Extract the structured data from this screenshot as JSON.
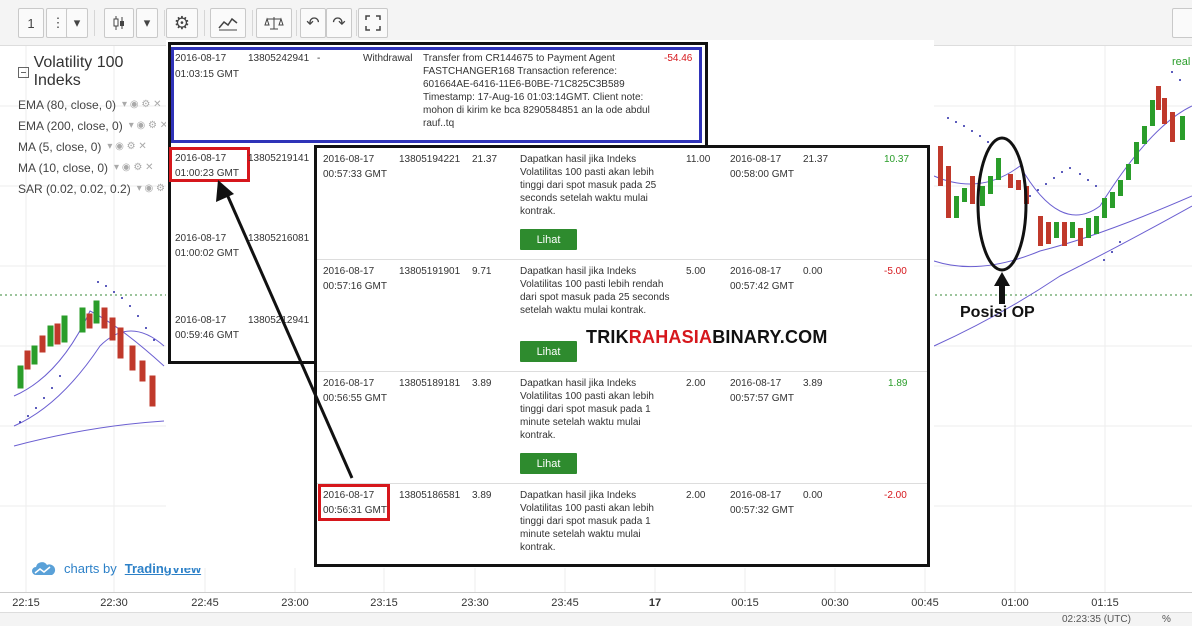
{
  "toolbar": {
    "interval": "1"
  },
  "chart": {
    "title": "Volatility 100 Indeks",
    "indicators": [
      "EMA (80, close, 0)",
      "EMA (200, close, 0)",
      "MA (5, close, 0)",
      "MA (10, close, 0)",
      "SAR (0.02, 0.02, 0.2)"
    ],
    "realtime_label": "real",
    "brand_prefix": "charts by",
    "brand_name": "TradingView",
    "time_ticks": [
      "22:15",
      "22:30",
      "22:45",
      "23:00",
      "23:15",
      "23:30",
      "23:45",
      "17",
      "00:15",
      "00:30",
      "00:45",
      "01:00",
      "01:15"
    ],
    "clock": "02:23:35 (UTC)",
    "percent": "%"
  },
  "withdrawal": {
    "date": "2016-08-17",
    "time": "01:03:15 GMT",
    "ref": "13805242941",
    "dash": "-",
    "type": "Withdrawal",
    "description": "Transfer from CR144675 to Payment Agent FASTCHANGER168 Transaction reference: 601664AE-6416-11E6-B0BE-71C825C3B589 Timestamp: 17-Aug-16 01:03:14GMT. Client note: mohon di kirim ke bca 8290584851 an la ode abdul rauf..tq",
    "amount": "-54.46"
  },
  "left_rows": [
    {
      "date": "2016-08-17",
      "time": "01:00:23 GMT",
      "ref": "13805219141"
    },
    {
      "date": "2016-08-17",
      "time": "01:00:02 GMT",
      "ref": "13805216081"
    },
    {
      "date": "2016-08-17",
      "time": "00:59:46 GMT",
      "ref": "13805212941"
    }
  ],
  "contracts": [
    {
      "date": "2016-08-17",
      "time": "00:57:33 GMT",
      "ref": "13805194221",
      "payout": "21.37",
      "description": "Dapatkan hasil jika Indeks Volatilitas 100 pasti akan lebih tinggi dari spot masuk pada 25 seconds setelah waktu mulai kontrak.",
      "stake": "11.00",
      "sell_date": "2016-08-17",
      "sell_time": "00:58:00 GMT",
      "sell_price": "21.37",
      "profit": "10.37",
      "button": "Lihat"
    },
    {
      "date": "2016-08-17",
      "time": "00:57:16 GMT",
      "ref": "13805191901",
      "payout": "9.71",
      "description": "Dapatkan hasil jika Indeks Volatilitas 100 pasti lebih rendah dari spot masuk pada 25 seconds setelah waktu mulai kontrak.",
      "stake": "5.00",
      "sell_date": "2016-08-17",
      "sell_time": "00:57:42 GMT",
      "sell_price": "0.00",
      "profit": "-5.00",
      "button": "Lihat"
    },
    {
      "date": "2016-08-17",
      "time": "00:56:55 GMT",
      "ref": "13805189181",
      "payout": "3.89",
      "description": "Dapatkan hasil jika Indeks Volatilitas 100 pasti akan lebih tinggi dari spot masuk pada 1 minute setelah waktu mulai kontrak.",
      "stake": "2.00",
      "sell_date": "2016-08-17",
      "sell_time": "00:57:57 GMT",
      "sell_price": "3.89",
      "profit": "1.89",
      "button": "Lihat"
    },
    {
      "date": "2016-08-17",
      "time": "00:56:31 GMT",
      "ref": "13805186581",
      "payout": "3.89",
      "description": "Dapatkan hasil jika Indeks Volatilitas 100 pasti akan lebih tinggi dari spot masuk pada 1 minute setelah waktu mulai kontrak.",
      "stake": "2.00",
      "sell_date": "2016-08-17",
      "sell_time": "00:57:32 GMT",
      "sell_price": "0.00",
      "profit": "-2.00",
      "button": "Lihat"
    }
  ],
  "watermark": {
    "part1": "TRIK",
    "part2": "RAHASIA",
    "part3": "BINARY.COM"
  },
  "annotation": "Posisi OP",
  "colors": {
    "accent_red": "#d6171c",
    "positive": "#2a9d2a",
    "button_green": "#2e8b2e",
    "blue_frame": "#2f33b8"
  }
}
